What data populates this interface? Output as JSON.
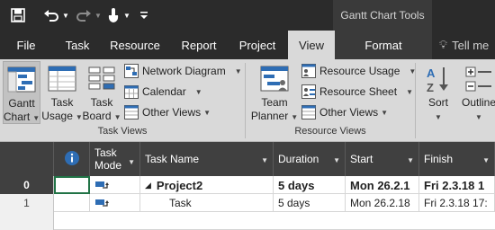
{
  "quick_access": {
    "save_icon": "save-icon",
    "undo_icon": "undo-icon",
    "redo_icon": "redo-icon",
    "touch_icon": "touch-mode-icon",
    "customize_icon": "customize-qat-icon"
  },
  "contextual": {
    "label": "Gantt Chart Tools"
  },
  "tabs": [
    {
      "label": "File"
    },
    {
      "label": "Task"
    },
    {
      "label": "Resource"
    },
    {
      "label": "Report"
    },
    {
      "label": "Project"
    },
    {
      "label": "View",
      "active": true
    },
    {
      "label": "Format"
    }
  ],
  "tell_me": {
    "label": "Tell me"
  },
  "ribbon": {
    "task_views": {
      "group_label": "Task Views",
      "gantt_chart": {
        "line1": "Gantt",
        "line2": "Chart"
      },
      "task_usage": {
        "line1": "Task",
        "line2": "Usage"
      },
      "task_board": {
        "line1": "Task",
        "line2": "Board"
      },
      "network_diagram": "Network Diagram",
      "calendar": "Calendar",
      "other_views": "Other Views"
    },
    "resource_views": {
      "group_label": "Resource Views",
      "team_planner": {
        "line1": "Team",
        "line2": "Planner"
      },
      "resource_usage": "Resource Usage",
      "resource_sheet": "Resource Sheet",
      "other_views": "Other Views"
    },
    "sort": {
      "label": "Sort"
    },
    "outline": {
      "label": "Outline"
    }
  },
  "grid": {
    "headers": {
      "info_icon": "info-icon",
      "task_mode": {
        "line1": "Task",
        "line2": "Mode"
      },
      "task_name": "Task Name",
      "duration": "Duration",
      "start": "Start",
      "finish": "Finish"
    },
    "rows": [
      {
        "num": "0",
        "name": "Project2",
        "duration": "5 days",
        "start": "Mon 26.2.1",
        "finish": "Fri 2.3.18 1",
        "summary": true
      },
      {
        "num": "1",
        "name": "Task",
        "duration": "5 days",
        "start": "Mon 26.2.18",
        "finish": "Fri 2.3.18 17:",
        "summary": false
      }
    ]
  },
  "colors": {
    "titlebar": "#2b2b2b",
    "ribbon": "#d9d9d9",
    "grid_header": "#404040",
    "accent_blue": "#2e6db4"
  }
}
